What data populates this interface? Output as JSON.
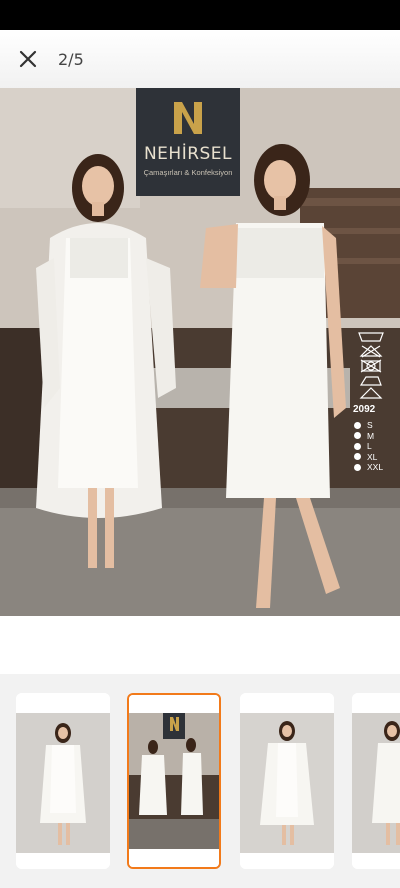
{
  "header": {
    "close_icon": "close-icon",
    "counter": "2/5"
  },
  "product_image": {
    "brand": {
      "logo_icon": "brand-logo-icon",
      "name": "NEHİRSEL",
      "tagline": "Çamaşırları & Konfeksiyon"
    },
    "care_icons": [
      "wash-icon",
      "no-bleach-icon",
      "no-tumble-dry-icon",
      "iron-icon",
      "no-dry-clean-icon"
    ],
    "model_code": "2092",
    "sizes": [
      "S",
      "M",
      "L",
      "XL",
      "XXL"
    ]
  },
  "thumbnails": [
    {
      "label": "thumbnail-1",
      "selected": false
    },
    {
      "label": "thumbnail-2",
      "selected": true
    },
    {
      "label": "thumbnail-3",
      "selected": false
    },
    {
      "label": "thumbnail-4",
      "selected": false
    }
  ],
  "colors": {
    "accent": "#f27a1a",
    "brand_box": "#2e3238",
    "brand_gold": "#c9a24a"
  }
}
